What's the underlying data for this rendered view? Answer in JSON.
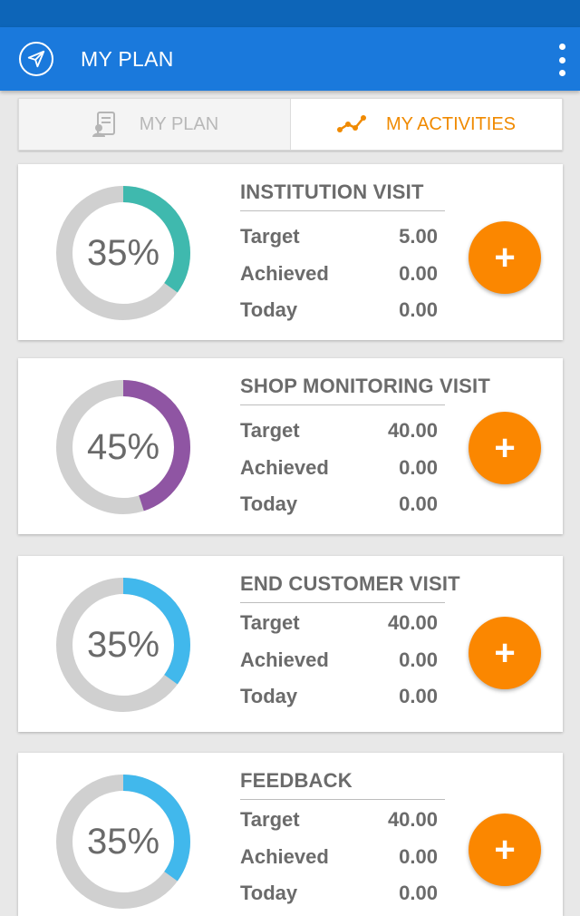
{
  "app_bar": {
    "title": "MY PLAN",
    "nav_icon": "navigation-arrow-icon",
    "menu_icon": "more-vertical-icon"
  },
  "tabs": [
    {
      "label": "MY PLAN",
      "icon": "plan-document-icon",
      "active": false
    },
    {
      "label": "MY ACTIVITIES",
      "icon": "activity-graph-icon",
      "active": true
    }
  ],
  "colors": {
    "status_bar": "#0d65b8",
    "app_bar": "#1a79dc",
    "accent": "#fb8700",
    "ring_track": "#d0d0d0"
  },
  "activities": [
    {
      "title": "INSTITUTION VISIT",
      "percent_label": "35%",
      "progress": 0.35,
      "ring_color": "#3fb9ae",
      "target_label": "Target",
      "target": "5.00",
      "achieved_label": "Achieved",
      "achieved": "0.00",
      "today_label": "Today",
      "today": "0.00",
      "add_label": "+"
    },
    {
      "title": "SHOP MONITORING VISIT",
      "percent_label": "45%",
      "progress": 0.45,
      "ring_color": "#8f55a3",
      "target_label": "Target",
      "target": "40.00",
      "achieved_label": "Achieved",
      "achieved": "0.00",
      "today_label": "Today",
      "today": "0.00",
      "add_label": "+"
    },
    {
      "title": "END CUSTOMER VISIT",
      "percent_label": "35%",
      "progress": 0.35,
      "ring_color": "#41b8ec",
      "target_label": "Target",
      "target": "40.00",
      "achieved_label": "Achieved",
      "achieved": "0.00",
      "today_label": "Today",
      "today": "0.00",
      "add_label": "+"
    },
    {
      "title": "FEEDBACK",
      "percent_label": "35%",
      "progress": 0.35,
      "ring_color": "#41b8ec",
      "target_label": "Target",
      "target": "40.00",
      "achieved_label": "Achieved",
      "achieved": "0.00",
      "today_label": "Today",
      "today": "0.00",
      "add_label": "+"
    }
  ]
}
